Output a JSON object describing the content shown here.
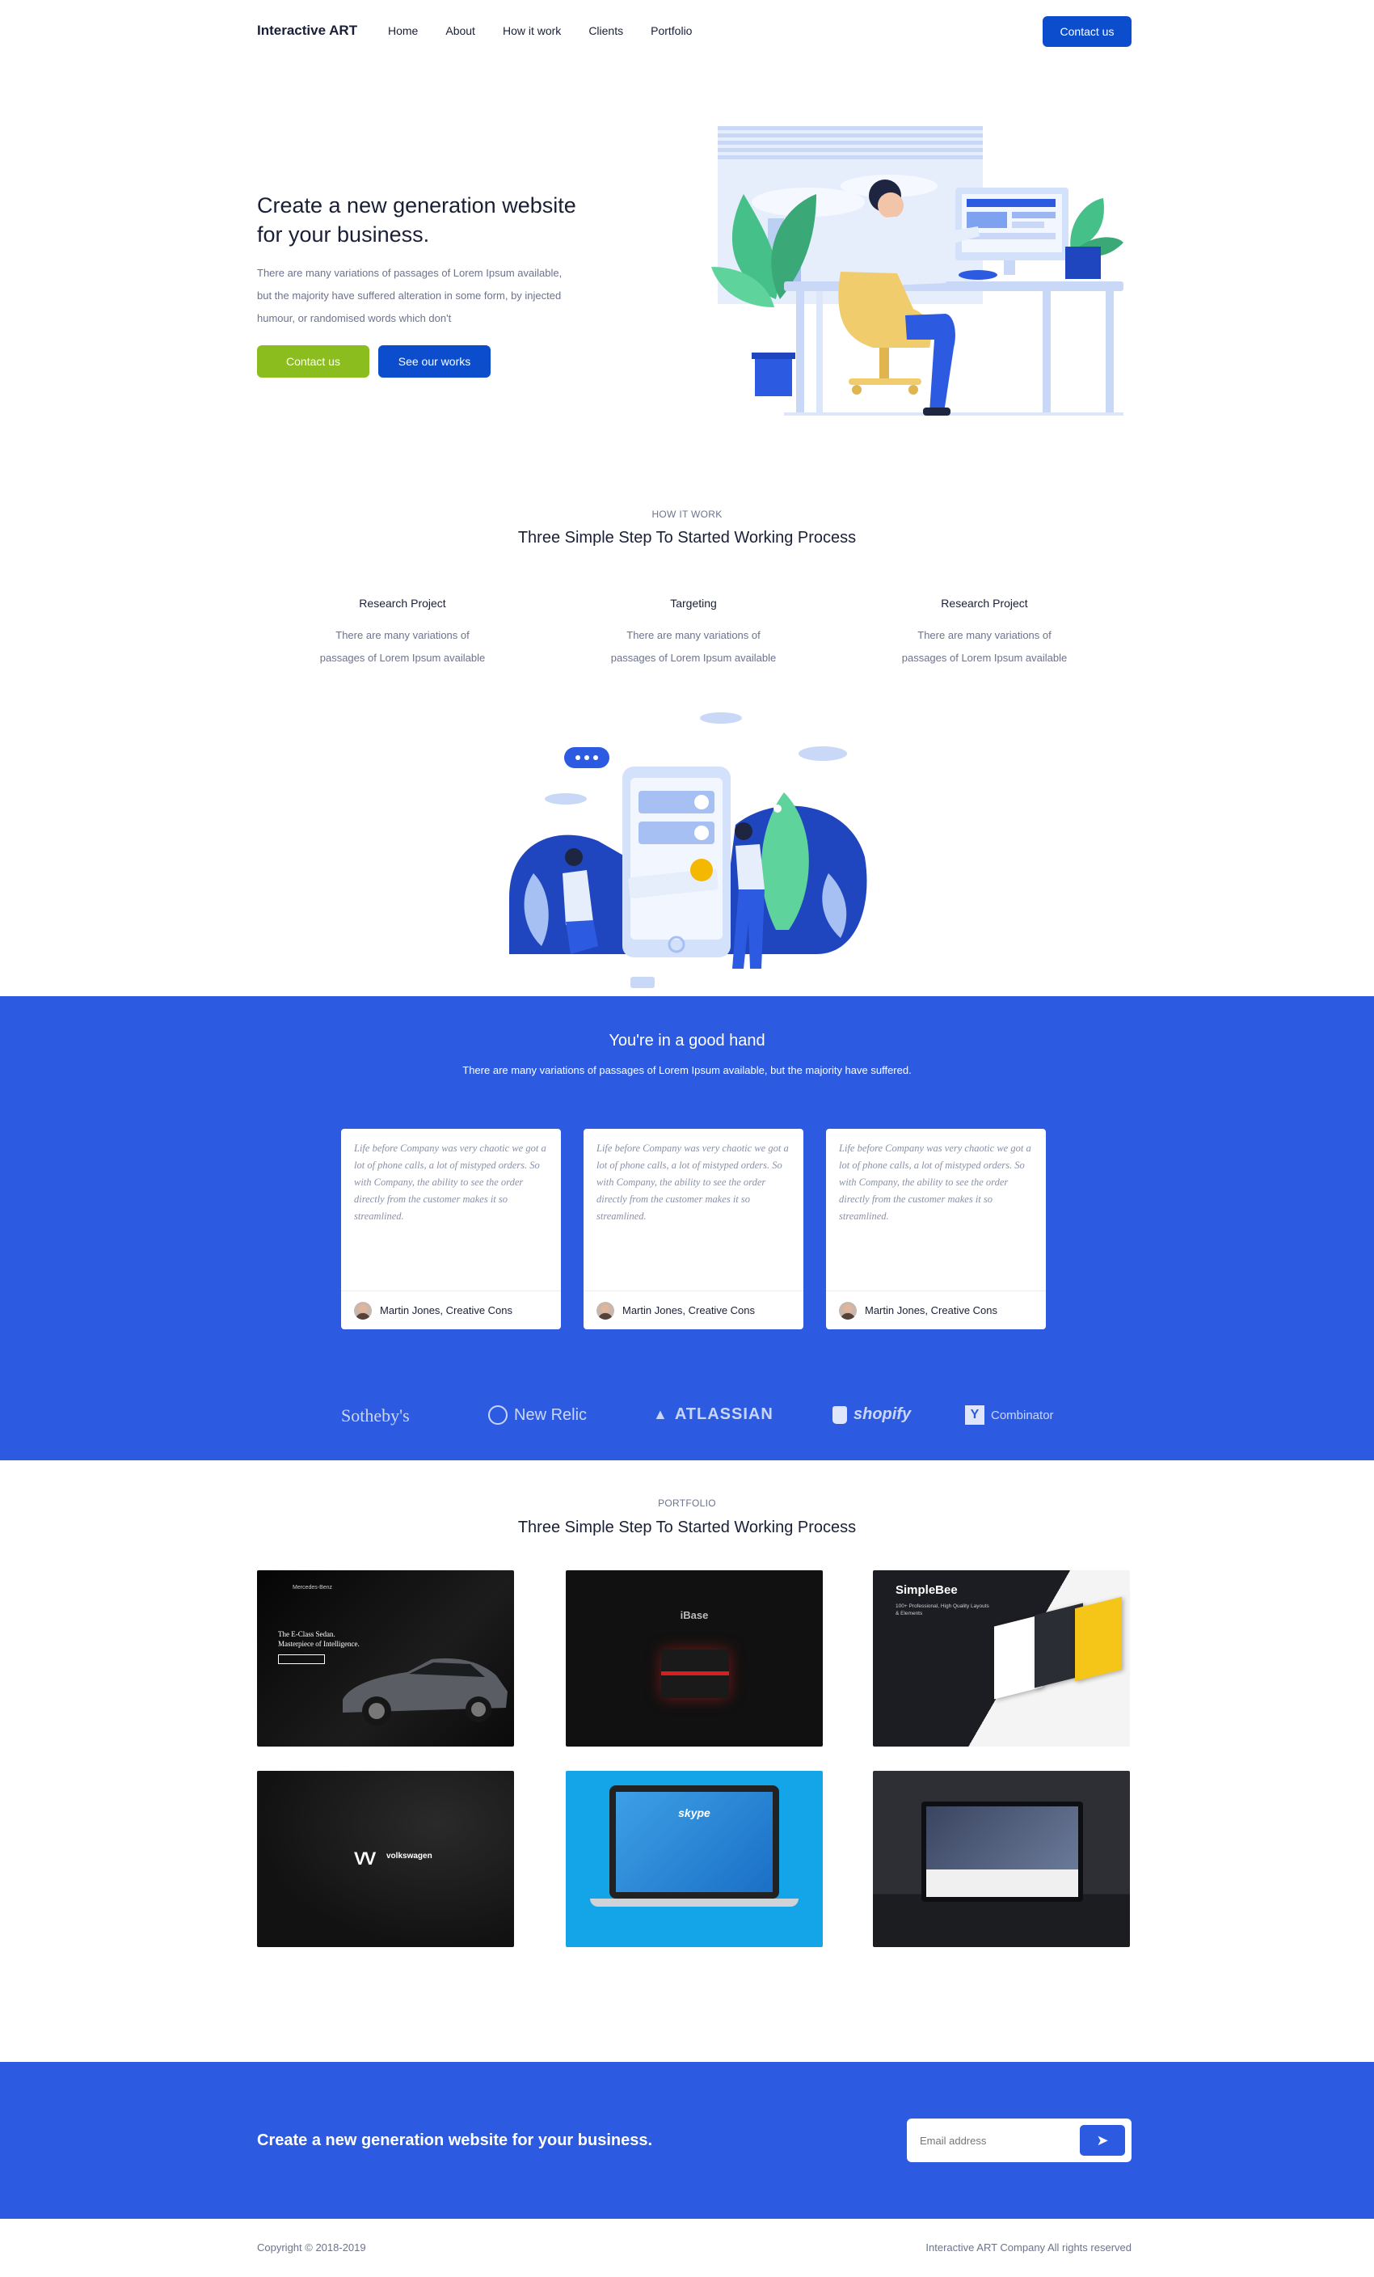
{
  "header": {
    "logo": "Interactive ART",
    "nav": [
      "Home",
      "About",
      "How it work",
      "Clients",
      "Portfolio"
    ],
    "cta_label": "Contact us"
  },
  "hero": {
    "title": "Create a new generation website for your business.",
    "text": "There are many variations of passages of Lorem Ipsum available, but the majority have suffered alteration in some form, by injected humour, or randomised words which don't",
    "primary_label": "Contact us",
    "secondary_label": "See our works"
  },
  "how": {
    "eyebrow": "HOW IT WORK",
    "title": "Three Simple Step To Started Working Process",
    "steps": [
      {
        "title": "Research Project",
        "text": "There are many variations of passages of Lorem Ipsum available"
      },
      {
        "title": "Targeting",
        "text": "There are many variations of passages of Lorem Ipsum available"
      },
      {
        "title": "Research Project",
        "text": "There are many variations of passages of Lorem Ipsum available"
      }
    ]
  },
  "testimonials": {
    "title": "You're in a good hand",
    "subtitle": "There are many variations of passages of Lorem Ipsum available, but the majority have suffered.",
    "cards": [
      {
        "quote": "Life before Company was very chaotic we got a lot of phone calls, a lot of mistyped orders. So with Company, the ability to see the order directly from the customer makes it so streamlined.",
        "author": "Martin Jones, Creative Cons"
      },
      {
        "quote": "Life before Company was very chaotic we got a lot of phone calls, a lot of mistyped orders. So with Company, the ability to see the order directly from the customer makes it so streamlined.",
        "author": "Martin Jones, Creative Cons"
      },
      {
        "quote": "Life before Company was very chaotic we got a lot of phone calls, a lot of mistyped orders. So with Company, the ability to see the order directly from the customer makes it so streamlined.",
        "author": "Martin Jones, Creative Cons"
      }
    ],
    "logos": [
      "Sotheby's",
      "New Relic",
      "ATLASSIAN",
      "shopify",
      "Combinator"
    ]
  },
  "portfolio": {
    "eyebrow": "PORTFOLIO",
    "title": "Three Simple Step To Started Working Process",
    "tiles": [
      {
        "caption_a": "Mercedes-Benz",
        "caption_b": "The E-Class Sedan.",
        "caption_c": "Masterpiece of Intelligence."
      },
      {
        "caption_a": "iBase"
      },
      {
        "caption_a": "SimpleBee",
        "caption_b": "100+ Professional, High Quality Layouts & Elements"
      },
      {
        "caption_a": "volkswagen"
      },
      {
        "caption_a": "skype"
      },
      {
        "caption_a": ""
      }
    ]
  },
  "cta": {
    "title": "Create a new generation website for your business.",
    "email_placeholder": "Email address"
  },
  "footer": {
    "copyright": "Copyright © 2018-2019",
    "rights": "Interactive ART Company All rights reserved"
  },
  "colors": {
    "brand_blue": "#2c5be2",
    "button_blue": "#0b4dcc",
    "green": "#8bbd1f"
  }
}
